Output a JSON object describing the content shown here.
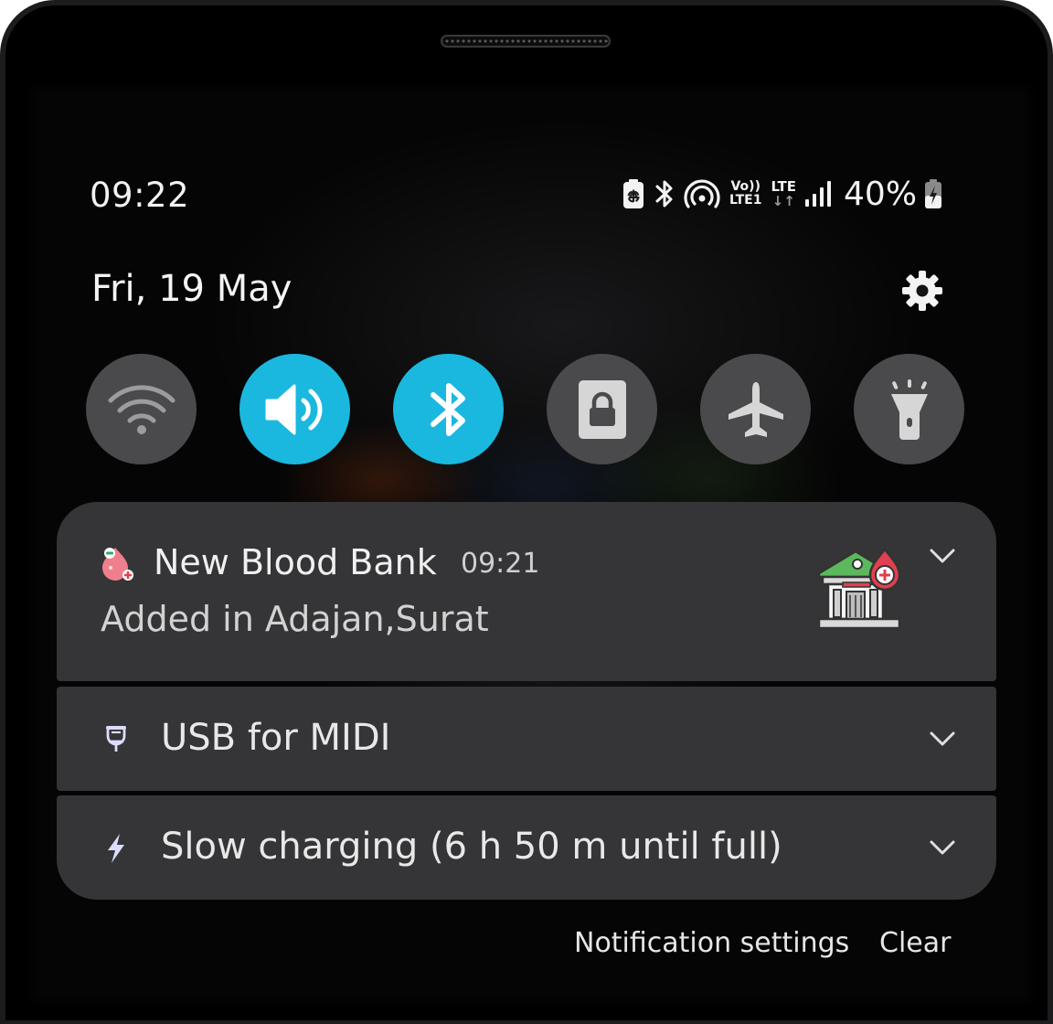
{
  "status_bar": {
    "time": "09:22",
    "volte_top": "Vo))",
    "volte_bottom": "LTE1",
    "lte_label": "LTE",
    "lte_arrows": "↓↑",
    "battery_percent": "40%",
    "icons": [
      "battery-saver-icon",
      "bluetooth-icon",
      "hotspot-icon",
      "volte-icon",
      "lte-icon",
      "signal-icon",
      "battery-charging-icon"
    ]
  },
  "header": {
    "date": "Fri, 19 May",
    "settings_icon": "gear-icon"
  },
  "quick_settings": [
    {
      "name": "wifi",
      "icon": "wifi-icon",
      "active": false
    },
    {
      "name": "sound",
      "icon": "speaker-icon",
      "active": true
    },
    {
      "name": "bluetooth",
      "icon": "bluetooth-icon",
      "active": true
    },
    {
      "name": "rotation-lock",
      "icon": "lock-icon",
      "active": false
    },
    {
      "name": "airplane-mode",
      "icon": "airplane-icon",
      "active": false
    },
    {
      "name": "flashlight",
      "icon": "flashlight-icon",
      "active": false
    }
  ],
  "notifications": [
    {
      "app_icon": "blood-drop-icon",
      "title": "New Blood Bank",
      "time": "09:21",
      "body": "Added in Adajan,Surat",
      "image": "blood-bank-building-icon"
    },
    {
      "icon": "usb-icon",
      "text": "USB for MIDI"
    },
    {
      "icon": "charging-bolt-icon",
      "text": "Slow charging (6 h 50 m until full)"
    }
  ],
  "footer": {
    "settings_label": "Notification settings",
    "clear_label": "Clear"
  },
  "colors": {
    "accent": "#1ab8de",
    "tile_inactive": "#4a4a4c",
    "card": "#353537"
  }
}
